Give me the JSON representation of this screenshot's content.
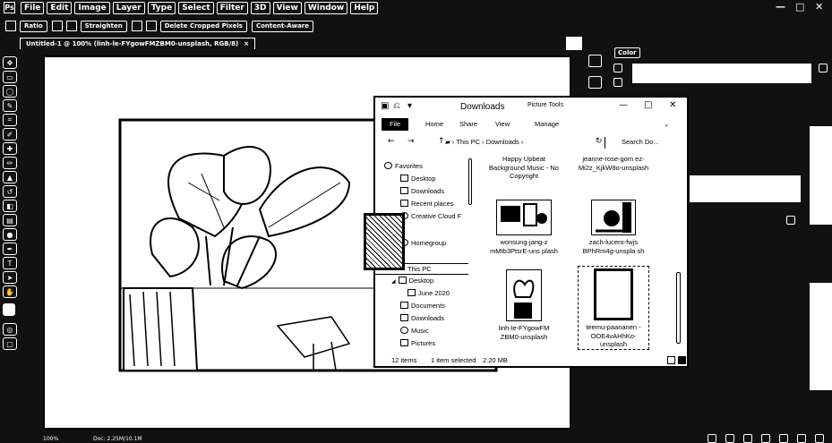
{
  "photoshop": {
    "logo": "Ps",
    "menu": [
      "File",
      "Edit",
      "Image",
      "Layer",
      "Type",
      "Select",
      "Filter",
      "3D",
      "View",
      "Window",
      "Help"
    ],
    "options_bar": [
      "Ratio",
      "Straighten",
      "Delete Cropped Pixels",
      "Content-Aware"
    ],
    "document_tab": "Untitled-1 @ 100% (linh-le-FYgowFMZBM0-unsplash, RGB/8)",
    "tab_close": "×",
    "window_controls": [
      "—",
      "□",
      "✕"
    ],
    "status": {
      "zoom": "100%",
      "doc_size": "Doc: 2.25M/10.1M"
    },
    "panels": {
      "color_tab": "Color"
    }
  },
  "explorer": {
    "quick_access_icons": [
      "save-icon",
      "undo-icon",
      "dropdown-icon"
    ],
    "title": "Downloads",
    "context_tab": "Picture Tools",
    "window_buttons": [
      "—",
      "□",
      "✕"
    ],
    "ribbon_tabs": {
      "file": "File",
      "home": "Home",
      "share": "Share",
      "view": "View",
      "manage": "Manage"
    },
    "address": {
      "back": "←",
      "forward": "→",
      "up": "↑",
      "path_root": "This PC",
      "path_sep": "›",
      "path_folder": "Downloads",
      "refresh": "↻",
      "search_placeholder": "Search Do..."
    },
    "nav": {
      "favorites": "Favorites",
      "desktop": "Desktop",
      "downloads": "Downloads",
      "recent_places": "Recent places",
      "creative_cloud": "Creative Cloud F",
      "homegroup": "Homegroup",
      "this_pc": "This PC",
      "desktop2": "Desktop",
      "june2020": "June 2020",
      "documents": "Documents",
      "downloads2": "Downloads",
      "music": "Music",
      "pictures": "Pictures"
    },
    "files": [
      {
        "name": "Happy Upbeat Background Music - No Copyright"
      },
      {
        "name": "jeanne-rose-gom ez-Mi2z_KjkW8o-unsplash"
      },
      {
        "name": "wonsung-jang-z mMtb3PtsrE-uns plash"
      },
      {
        "name": "zach-lucero-fwjs BPhRm4g-unspla sh"
      },
      {
        "name": "linh-le-FYgowFM ZBM0-unsplash"
      },
      {
        "name": "teemu-paananen -OOE4vAHhKo-unsplash"
      }
    ],
    "status": {
      "count": "12 items",
      "selected": "1 item selected",
      "size": "2.20 MB"
    }
  }
}
